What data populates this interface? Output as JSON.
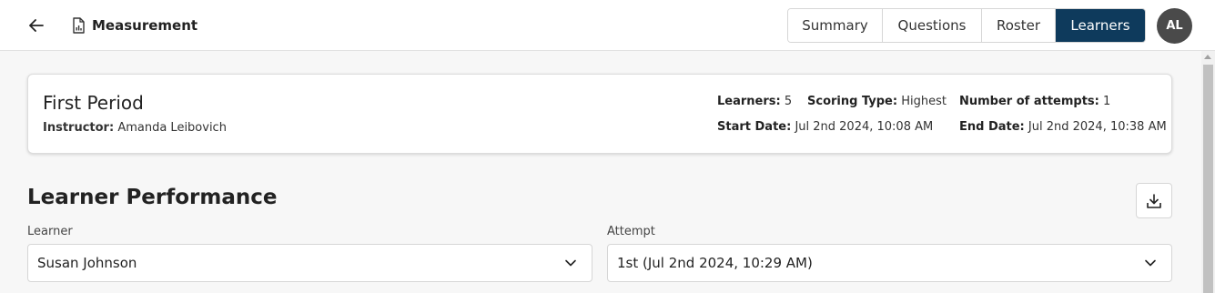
{
  "header": {
    "title": "Measurement",
    "tabs": [
      {
        "label": "Summary",
        "active": false
      },
      {
        "label": "Questions",
        "active": false
      },
      {
        "label": "Roster",
        "active": false
      },
      {
        "label": "Learners",
        "active": true
      }
    ],
    "avatar_initials": "AL",
    "icons": {
      "back": "arrow-left-icon",
      "document": "chart-document-icon"
    }
  },
  "class_card": {
    "name": "First Period",
    "instructor_label": "Instructor:",
    "instructor": "Amanda Leibovich",
    "learners_label": "Learners:",
    "learners": "5",
    "scoring_type_label": "Scoring Type:",
    "scoring_type": "Highest",
    "attempts_label": "Number of attempts:",
    "attempts": "1",
    "start_date_label": "Start Date:",
    "start_date": "Jul 2nd 2024, 10:08 AM",
    "end_date_label": "End Date:",
    "end_date": "Jul 2nd 2024, 10:38 AM"
  },
  "performance": {
    "title": "Learner Performance",
    "download_icon": "download-icon",
    "learner_label": "Learner",
    "learner_value": "Susan Johnson",
    "attempt_label": "Attempt",
    "attempt_value": "1st (Jul 2nd 2024, 10:29 AM)"
  },
  "colors": {
    "accent": "#0e3a5c",
    "avatar_bg": "#4a4a4a",
    "page_bg": "#f7f7f7"
  }
}
